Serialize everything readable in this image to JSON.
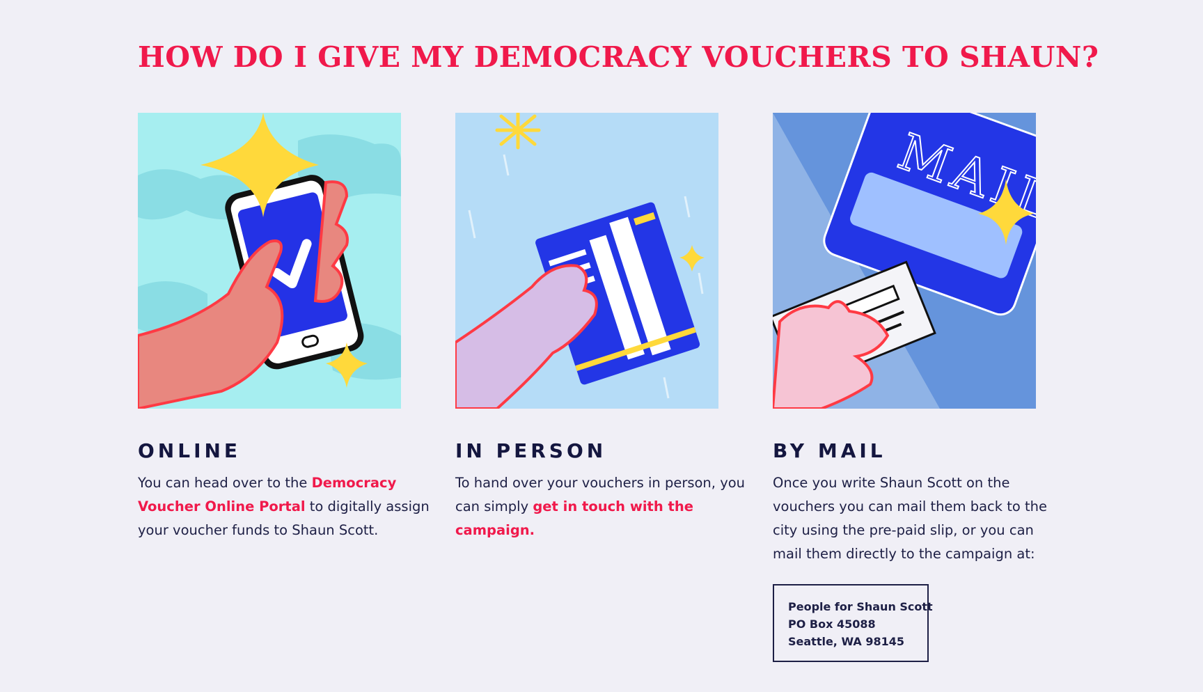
{
  "heading": "HOW DO I GIVE MY DEMOCRACY VOUCHERS TO SHAUN?",
  "colors": {
    "accent": "#f0194b",
    "text": "#1d1f45",
    "background": "#f0eff6"
  },
  "methods": [
    {
      "title": "ONLINE",
      "illustration": "hand-holding-phone-with-checkmark",
      "body": {
        "before": "You can head over to the ",
        "link": "Democracy Voucher Online Portal",
        "after": " to digitally assign your voucher funds to Shaun Scott."
      }
    },
    {
      "title": "IN PERSON",
      "illustration": "hand-holding-voucher",
      "body": {
        "before": "To hand over your vouchers in person, you can simply ",
        "link": "get in touch with the campaign.",
        "after": ""
      }
    },
    {
      "title": "BY MAIL",
      "illustration": "hand-mailing-envelope",
      "illustration_text": "MAIL",
      "body": {
        "before": "Once you write Shaun Scott on the vouchers you can mail them back to the city using the pre-paid slip, or you can mail them directly to the campaign at:",
        "link": "",
        "after": ""
      },
      "address": {
        "name": "People for Shaun Scott",
        "line1": "PO Box 45088",
        "line2": "Seattle, WA 98145"
      }
    }
  ]
}
